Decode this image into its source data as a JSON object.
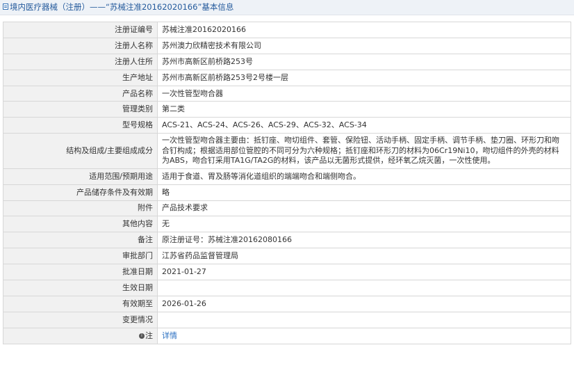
{
  "header": {
    "title": "境内医疗器械（注册）——“苏械注准20162020166”基本信息",
    "icon": "document-icon"
  },
  "rows": [
    {
      "label": "注册证编号",
      "value": "苏械注准20162020166"
    },
    {
      "label": "注册人名称",
      "value": "苏州澳力欣精密技术有限公司"
    },
    {
      "label": "注册人住所",
      "value": "苏州市高新区前桥路253号"
    },
    {
      "label": "生产地址",
      "value": "苏州市高新区前桥路253号2号楼一层"
    },
    {
      "label": "产品名称",
      "value": "一次性管型吻合器"
    },
    {
      "label": "管理类别",
      "value": "第二类"
    },
    {
      "label": "型号规格",
      "value": "ACS-21、ACS-24、ACS-26、ACS-29、ACS-32、ACS-34"
    },
    {
      "label": "结构及组成/主要组成成分",
      "value": "一次性管型吻合器主要由：抵钉座、吻切组件、套管、保险钮、活动手柄、固定手柄、调节手柄、垫刀圈、环形刀和吻合钉构成；根据适用部位管腔的不同可分为六种规格；抵钉座和环形刀的材料为06Cr19Ni10，吻切组件的外壳的材料为ABS，吻合钉采用TA1G/TA2G的材料，该产品以无菌形式提供，经环氧乙烷灭菌，一次性使用。"
    },
    {
      "label": "适用范围/预期用途",
      "value": "适用于食道、胃及肠等消化道组织的端端吻合和端侧吻合。"
    },
    {
      "label": "产品储存条件及有效期",
      "value": "略"
    },
    {
      "label": "附件",
      "value": "产品技术要求"
    },
    {
      "label": "其他内容",
      "value": "无"
    },
    {
      "label": "备注",
      "value": "原注册证号：苏械注准20162080166"
    },
    {
      "label": "审批部门",
      "value": "江苏省药品监督管理局"
    },
    {
      "label": "批准日期",
      "value": "2021-01-27"
    },
    {
      "label": "生效日期",
      "value": ""
    },
    {
      "label": "有效期至",
      "value": "2026-01-26"
    },
    {
      "label": "变更情况",
      "value": ""
    }
  ],
  "note_row": {
    "icon": "info-icon",
    "label": "注",
    "link_text": "详情"
  },
  "colors": {
    "header_bg": "#eef2f7",
    "header_text": "#245a9c",
    "label_bg": "#f1f1f1",
    "border": "#d7d7d7",
    "link": "#2a6fc1"
  }
}
